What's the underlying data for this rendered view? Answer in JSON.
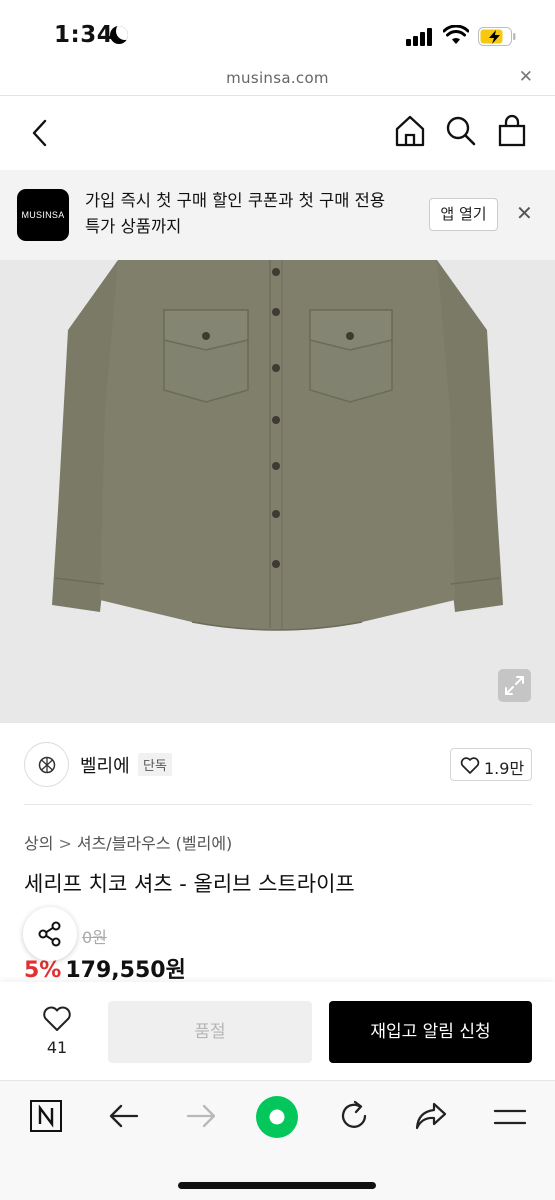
{
  "status_bar": {
    "time": "1:34"
  },
  "browser": {
    "url": "musinsa.com"
  },
  "promo": {
    "logo_text": "MUSINSA",
    "message": "가입 즉시 첫 구매 할인 쿠폰과 첫 구매 전용 특가 상품까지",
    "open_app_label": "앱 열기"
  },
  "brand": {
    "name": "벨리에",
    "badge": "단독",
    "like_count": "1.9만"
  },
  "breadcrumb": {
    "level1": "상의",
    "separator": ">",
    "level2": "셔츠/블라우스 (벨리에)"
  },
  "product": {
    "title": "세리프 치코 셔츠 - 올리브 스트라이프",
    "original_price": "0원",
    "discount": "5%",
    "price": "179,550원"
  },
  "action_bar": {
    "wish_count": "41",
    "soldout_label": "품절",
    "restock_label": "재입고 알림 신청"
  },
  "colors": {
    "shirt": "#7d7d6a",
    "image_bg": "#e8e8e8",
    "discount": "#e23030",
    "browser_accent": "#03c75a"
  },
  "icons": {
    "header": [
      "back-arrow-icon",
      "home-icon",
      "search-icon",
      "shopping-bag-icon"
    ],
    "toolbar": [
      "naver-icon",
      "back-icon",
      "forward-icon",
      "green-dot-icon",
      "refresh-icon",
      "share-icon",
      "menu-icon"
    ]
  }
}
